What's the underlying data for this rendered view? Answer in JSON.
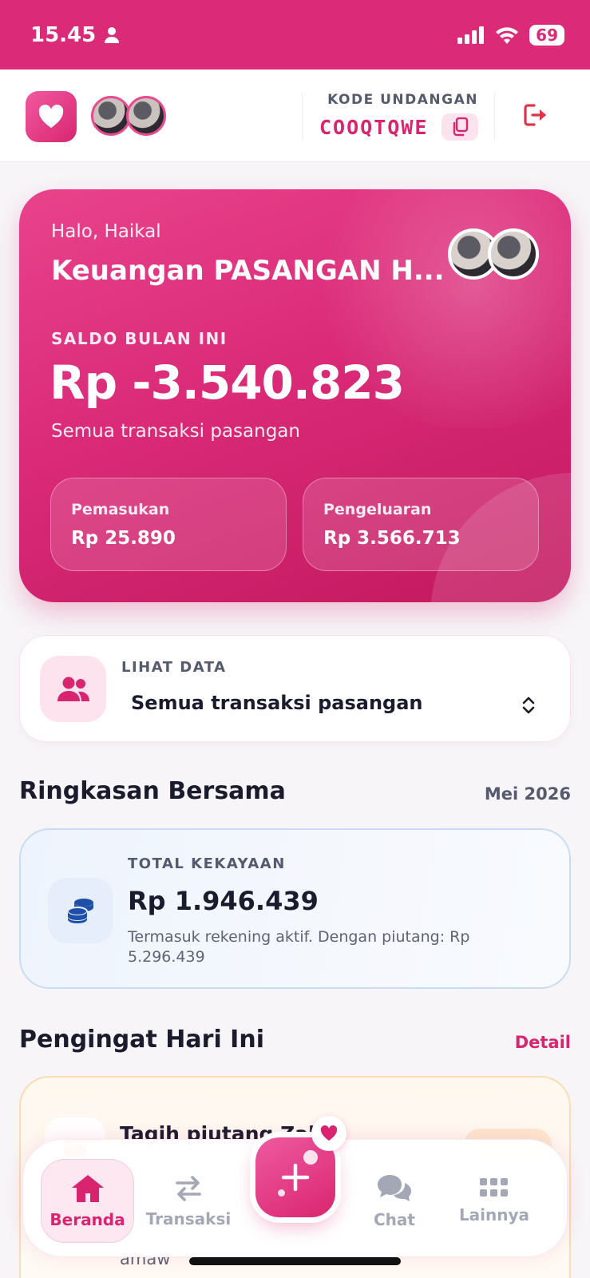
{
  "status_bar": {
    "time": "15.45",
    "battery": "69"
  },
  "header": {
    "invite_label": "KODE UNDANGAN",
    "invite_code": "COOQTQWE"
  },
  "balance_card": {
    "greeting": "Halo, Haikal",
    "title": "Keuangan PASANGAN H...",
    "saldo_label": "SALDO BULAN INI",
    "saldo_value": "Rp -3.540.823",
    "saldo_sub": "Semua transaksi pasangan",
    "income": {
      "label": "Pemasukan",
      "value": "Rp 25.890"
    },
    "expense": {
      "label": "Pengeluaran",
      "value": "Rp 3.566.713"
    }
  },
  "filter": {
    "label": "LIHAT DATA",
    "selected": "Semua transaksi pasangan"
  },
  "summary": {
    "title": "Ringkasan Bersama",
    "period": "Mei 2026",
    "wealth_label": "TOTAL KEKAYAAN",
    "wealth_value": "Rp 1.946.439",
    "wealth_desc": "Termasuk rekening aktif. Dengan piutang: Rp 5.296.439"
  },
  "reminders": {
    "title": "Pengingat Hari Ini",
    "detail_link": "Detail",
    "first_item_title": "Tagih piutang Zaki",
    "first_item_sub": "amaw"
  },
  "bottom_nav": {
    "items": [
      {
        "label": "Beranda",
        "icon": "home-icon",
        "active": true
      },
      {
        "label": "Transaksi",
        "icon": "swap-icon",
        "active": false
      },
      {
        "label": "Chat",
        "icon": "chat-icon",
        "active": false
      },
      {
        "label": "Lainnya",
        "icon": "grid-icon",
        "active": false
      }
    ]
  },
  "colors": {
    "brand_pink": "#da2a78",
    "text_dark": "#1b1b2e",
    "muted": "#555a6e",
    "wealth_blue": "#1e4fa8"
  }
}
